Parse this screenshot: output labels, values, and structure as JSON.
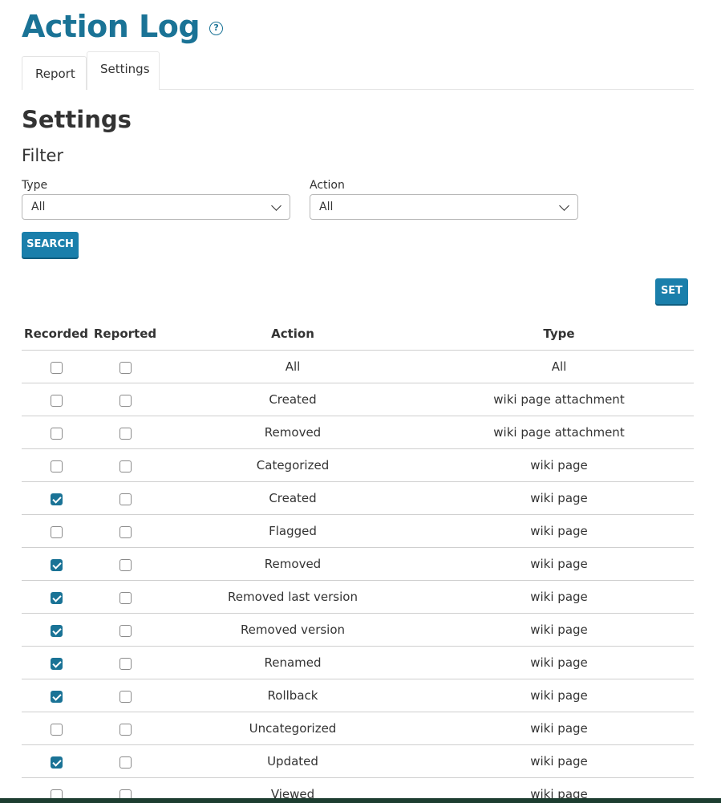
{
  "header": {
    "title": "Action Log",
    "help_glyph": "?"
  },
  "tabs": [
    {
      "label": "Report",
      "active": false
    },
    {
      "label": "Settings",
      "active": true
    }
  ],
  "section_title": "Settings",
  "filter": {
    "title": "Filter",
    "type_label": "Type",
    "type_value": "All",
    "action_label": "Action",
    "action_value": "All",
    "search_label": "SEARCH"
  },
  "set_label": "SET",
  "table": {
    "headers": {
      "recorded": "Recorded",
      "reported": "Reported",
      "action": "Action",
      "type": "Type"
    },
    "rows": [
      {
        "recorded": false,
        "reported": false,
        "action": "All",
        "type": "All"
      },
      {
        "recorded": false,
        "reported": false,
        "action": "Created",
        "type": "wiki page attachment"
      },
      {
        "recorded": false,
        "reported": false,
        "action": "Removed",
        "type": "wiki page attachment"
      },
      {
        "recorded": false,
        "reported": false,
        "action": "Categorized",
        "type": "wiki page"
      },
      {
        "recorded": true,
        "reported": false,
        "action": "Created",
        "type": "wiki page"
      },
      {
        "recorded": false,
        "reported": false,
        "action": "Flagged",
        "type": "wiki page"
      },
      {
        "recorded": true,
        "reported": false,
        "action": "Removed",
        "type": "wiki page"
      },
      {
        "recorded": true,
        "reported": false,
        "action": "Removed last version",
        "type": "wiki page"
      },
      {
        "recorded": true,
        "reported": false,
        "action": "Removed version",
        "type": "wiki page"
      },
      {
        "recorded": true,
        "reported": false,
        "action": "Renamed",
        "type": "wiki page"
      },
      {
        "recorded": true,
        "reported": false,
        "action": "Rollback",
        "type": "wiki page"
      },
      {
        "recorded": false,
        "reported": false,
        "action": "Uncategorized",
        "type": "wiki page"
      },
      {
        "recorded": true,
        "reported": false,
        "action": "Updated",
        "type": "wiki page"
      },
      {
        "recorded": false,
        "reported": false,
        "action": "Viewed",
        "type": "wiki page"
      }
    ]
  },
  "colors": {
    "accent": "#1a7396",
    "button": "#1a7fab",
    "footer": "#1d3d30"
  }
}
